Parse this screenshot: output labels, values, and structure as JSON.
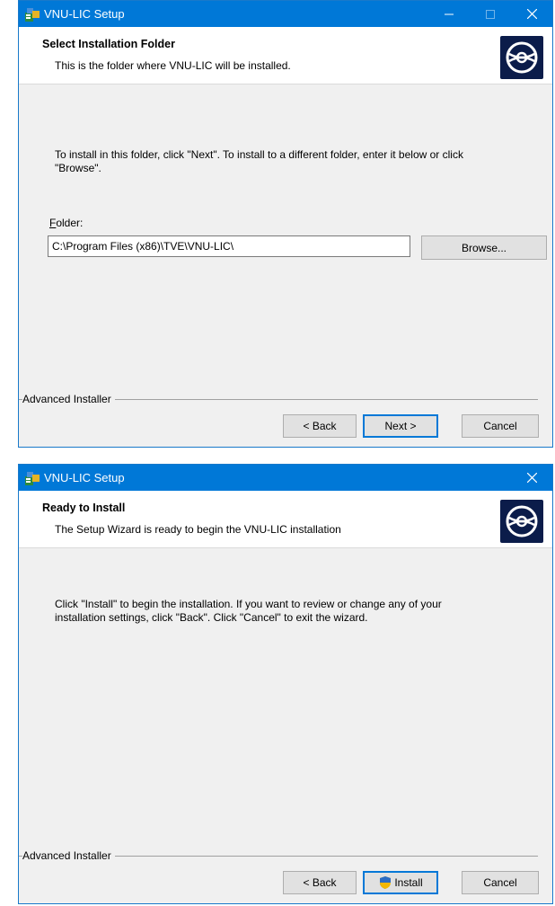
{
  "window1": {
    "title": "VNU-LIC Setup",
    "header_title": "Select Installation Folder",
    "header_subtitle": "This is the folder where VNU-LIC will be installed.",
    "instruction_line1": "To install in this folder, click \"Next\". To install to a different folder, enter it below or click",
    "instruction_line2": "\"Browse\".",
    "folder_label_accesskey": "F",
    "folder_label_rest": "older:",
    "folder_value": "C:\\Program Files (x86)\\TVE\\VNU-LIC\\",
    "browse_label": "Browse...",
    "brand": "Advanced Installer",
    "back_label": "< Back",
    "next_label": "Next >",
    "cancel_label": "Cancel"
  },
  "window2": {
    "title": "VNU-LIC Setup",
    "header_title": "Ready to Install",
    "header_subtitle": "The Setup Wizard is ready to begin the VNU-LIC installation",
    "instruction_line1": "Click \"Install\" to begin the installation.  If you want to review or change any of your",
    "instruction_line2": "installation settings, click \"Back\".  Click \"Cancel\" to exit the wizard.",
    "brand": "Advanced Installer",
    "back_label": "< Back",
    "install_label": "Install",
    "cancel_label": "Cancel"
  },
  "icons": {
    "app": "installer-icon",
    "logo": "disc-icon",
    "shield": "uac-shield-icon"
  },
  "colors": {
    "titlebar": "#0078d7",
    "dialog_bg": "#f0f0f0",
    "logo_bg": "#0b1c4a",
    "default_button_border": "#0078d7"
  }
}
